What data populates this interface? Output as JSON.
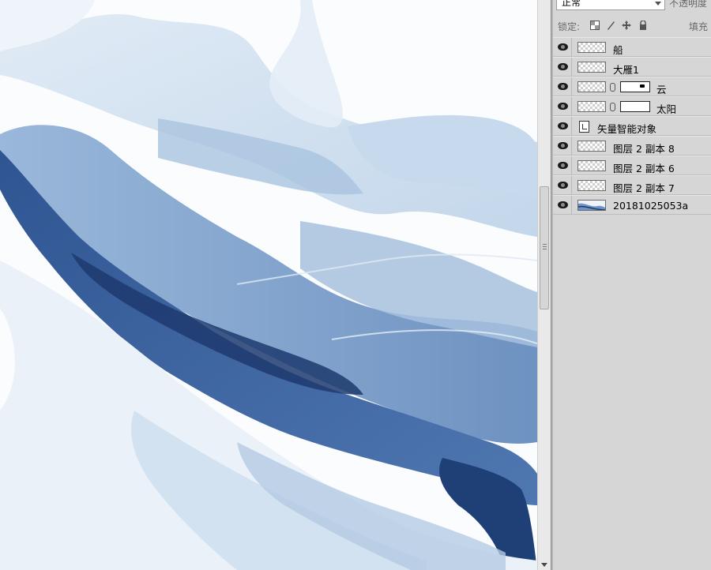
{
  "layers_panel": {
    "blend_mode": "正常",
    "opacity_label": "不透明度",
    "lock_label": "锁定:",
    "fill_label": "填充",
    "lock_icons": [
      "lock-transparent-icon",
      "lock-brush-icon",
      "lock-move-icon",
      "lock-all-icon"
    ],
    "layers": [
      {
        "name": "船",
        "visible": true,
        "thumb": "transparent"
      },
      {
        "name": "大雁1",
        "visible": true,
        "thumb": "transparent"
      },
      {
        "name": "云",
        "visible": true,
        "thumb": "transparent",
        "mask": true
      },
      {
        "name": "太阳",
        "visible": true,
        "thumb": "transparent",
        "mask": true
      },
      {
        "name": "矢量智能对象",
        "visible": true,
        "thumb": "smart-object"
      },
      {
        "name": "图层 2 副本 8",
        "visible": true,
        "thumb": "transparent"
      },
      {
        "name": "图层 2 副本 6",
        "visible": true,
        "thumb": "transparent"
      },
      {
        "name": "图层 2 副本 7",
        "visible": true,
        "thumb": "transparent"
      },
      {
        "name": "20181025053a",
        "visible": true,
        "thumb": "image"
      }
    ]
  },
  "colors": {
    "panel_bg": "#d6d6d6",
    "ink_light": "#c9dcee",
    "ink_mid": "#7ea3cc",
    "ink_dark": "#1d3a6e"
  }
}
